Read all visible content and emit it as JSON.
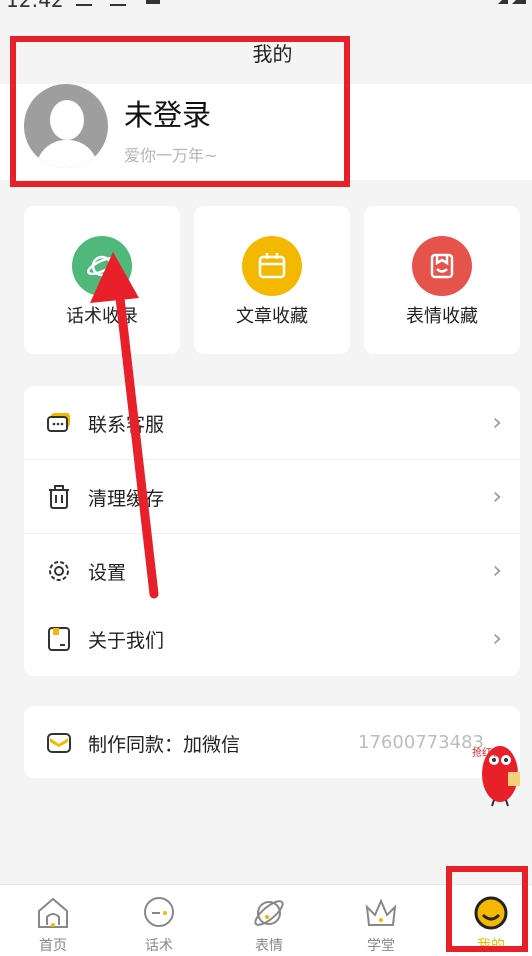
{
  "status_bar": {
    "time": "12:42"
  },
  "header": {
    "title": "我的"
  },
  "profile": {
    "name": "未登录",
    "motto": "爱你一万年~"
  },
  "quick_cards": [
    {
      "label": "话术收录",
      "icon": "planet-icon",
      "color": "#4fb87a"
    },
    {
      "label": "文章收藏",
      "icon": "calendar-icon",
      "color": "#f5b800"
    },
    {
      "label": "表情收藏",
      "icon": "bookmark-smile-icon",
      "color": "#e5534b"
    }
  ],
  "menu": [
    {
      "label": "联系客服",
      "icon": "chat-icon"
    },
    {
      "label": "清理缓存",
      "icon": "trash-icon"
    },
    {
      "label": "设置",
      "icon": "gear-icon"
    },
    {
      "label": "关于我们",
      "icon": "info-card-icon"
    }
  ],
  "promo": {
    "label": "制作同款：加微信",
    "phone": "17600773483",
    "icon": "mail-icon"
  },
  "mascot": {
    "icon": "red-envelope-mascot-icon",
    "text": "抢红包"
  },
  "bottom_nav": {
    "tabs": [
      {
        "label": "首页",
        "icon": "home-icon"
      },
      {
        "label": "话术",
        "icon": "message-icon"
      },
      {
        "label": "表情",
        "icon": "planet-icon"
      },
      {
        "label": "学堂",
        "icon": "crown-icon"
      },
      {
        "label": "我的",
        "icon": "smile-face-icon",
        "active": true
      }
    ]
  },
  "colors": {
    "accent": "#f5b800",
    "highlight": "#e8202a",
    "background": "#f4f4f4"
  }
}
